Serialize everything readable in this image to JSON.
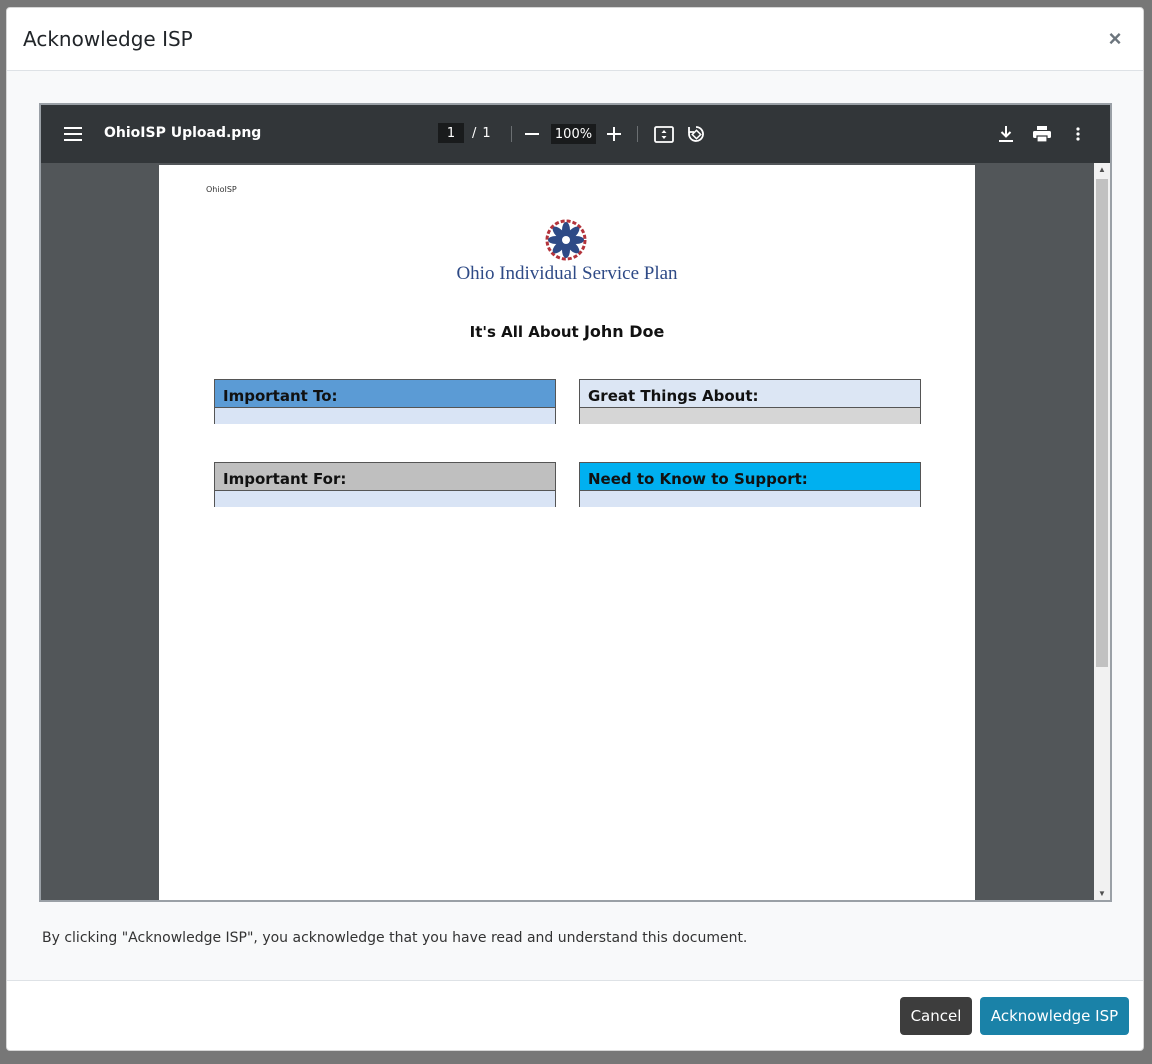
{
  "modal": {
    "title": "Acknowledge ISP",
    "close_label": "×"
  },
  "pdf_viewer": {
    "filename": "OhioISP Upload.png",
    "current_page": "1",
    "page_separator": "/",
    "total_pages": "1",
    "zoom": "100%",
    "icons": {
      "menu": "menu-icon",
      "zoom_out": "minus-icon",
      "zoom_in": "plus-icon",
      "fit": "fit-page-icon",
      "rotate": "rotate-icon",
      "download": "download-icon",
      "print": "print-icon",
      "more": "more-vertical-icon"
    }
  },
  "document": {
    "header_text": "OhioISP",
    "logo_text": "Ohio Individual Service Plan",
    "title_prefix": "It's All About",
    "title_name": "John Doe",
    "boxes": [
      {
        "label": "Important To:",
        "head_color": "#5b9bd5",
        "body_color": "#d9e4f5"
      },
      {
        "label": "Great Things About:",
        "head_color": "#dce6f4",
        "body_color": "#d6d6d6"
      },
      {
        "label": "Important For:",
        "head_color": "#bfbfbf",
        "body_color": "#d9e4f5"
      },
      {
        "label": "Need to Know to Support:",
        "head_color": "#00b0f0",
        "body_color": "#d9e4f5"
      }
    ]
  },
  "acknowledgement_text": "By clicking \"Acknowledge ISP\", you acknowledge that you have read and understand this document.",
  "footer": {
    "cancel_label": "Cancel",
    "acknowledge_label": "Acknowledge ISP"
  }
}
